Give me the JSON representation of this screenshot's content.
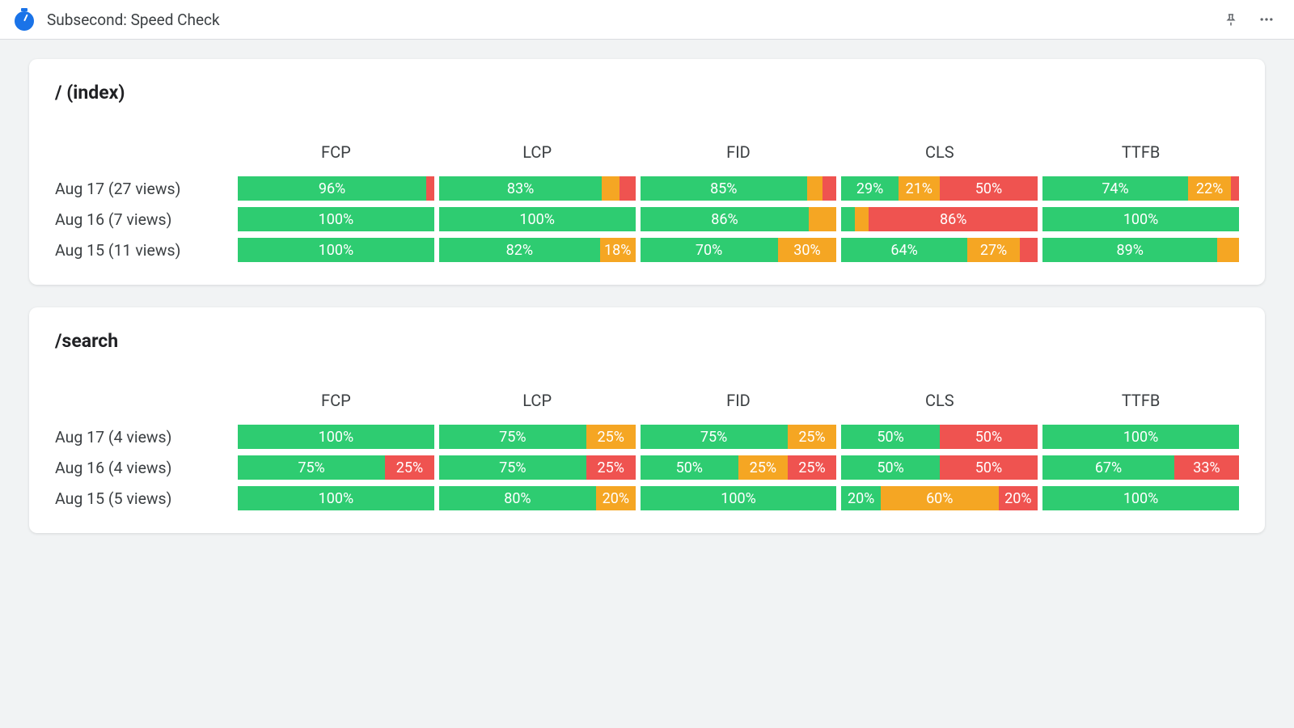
{
  "header": {
    "title": "Subsecond: Speed Check"
  },
  "metrics": [
    "FCP",
    "LCP",
    "FID",
    "CLS",
    "TTFB"
  ],
  "colors": {
    "green": "#2ecc71",
    "orange": "#f5a623",
    "red": "#ef5350"
  },
  "label_threshold_pct": 18,
  "cards": [
    {
      "title": "/ (index)",
      "rows": [
        {
          "label": "Aug 17 (27 views)",
          "cells": [
            [
              {
                "pct": 96,
                "cls": "green"
              },
              {
                "pct": 4,
                "cls": "red"
              }
            ],
            [
              {
                "pct": 83,
                "cls": "green"
              },
              {
                "pct": 9,
                "cls": "orange"
              },
              {
                "pct": 8,
                "cls": "red"
              }
            ],
            [
              {
                "pct": 85,
                "cls": "green"
              },
              {
                "pct": 8,
                "cls": "orange"
              },
              {
                "pct": 7,
                "cls": "red"
              }
            ],
            [
              {
                "pct": 29,
                "cls": "green"
              },
              {
                "pct": 21,
                "cls": "orange"
              },
              {
                "pct": 50,
                "cls": "red"
              }
            ],
            [
              {
                "pct": 74,
                "cls": "green"
              },
              {
                "pct": 22,
                "cls": "orange"
              },
              {
                "pct": 4,
                "cls": "red"
              }
            ]
          ]
        },
        {
          "label": "Aug 16 (7 views)",
          "cells": [
            [
              {
                "pct": 100,
                "cls": "green"
              }
            ],
            [
              {
                "pct": 100,
                "cls": "green"
              }
            ],
            [
              {
                "pct": 86,
                "cls": "green"
              },
              {
                "pct": 14,
                "cls": "orange"
              }
            ],
            [
              {
                "pct": 7,
                "cls": "green"
              },
              {
                "pct": 7,
                "cls": "orange"
              },
              {
                "pct": 86,
                "cls": "red"
              }
            ],
            [
              {
                "pct": 100,
                "cls": "green"
              }
            ]
          ]
        },
        {
          "label": "Aug 15 (11 views)",
          "cells": [
            [
              {
                "pct": 100,
                "cls": "green"
              }
            ],
            [
              {
                "pct": 82,
                "cls": "green"
              },
              {
                "pct": 18,
                "cls": "orange"
              }
            ],
            [
              {
                "pct": 70,
                "cls": "green"
              },
              {
                "pct": 30,
                "cls": "orange"
              }
            ],
            [
              {
                "pct": 64,
                "cls": "green"
              },
              {
                "pct": 27,
                "cls": "orange"
              },
              {
                "pct": 9,
                "cls": "red"
              }
            ],
            [
              {
                "pct": 89,
                "cls": "green"
              },
              {
                "pct": 11,
                "cls": "orange"
              }
            ]
          ]
        }
      ]
    },
    {
      "title": "/search",
      "rows": [
        {
          "label": "Aug 17 (4 views)",
          "cells": [
            [
              {
                "pct": 100,
                "cls": "green"
              }
            ],
            [
              {
                "pct": 75,
                "cls": "green"
              },
              {
                "pct": 25,
                "cls": "orange"
              }
            ],
            [
              {
                "pct": 75,
                "cls": "green"
              },
              {
                "pct": 25,
                "cls": "orange"
              }
            ],
            [
              {
                "pct": 50,
                "cls": "green"
              },
              {
                "pct": 50,
                "cls": "red"
              }
            ],
            [
              {
                "pct": 100,
                "cls": "green"
              }
            ]
          ]
        },
        {
          "label": "Aug 16 (4 views)",
          "cells": [
            [
              {
                "pct": 75,
                "cls": "green"
              },
              {
                "pct": 25,
                "cls": "red"
              }
            ],
            [
              {
                "pct": 75,
                "cls": "green"
              },
              {
                "pct": 25,
                "cls": "red"
              }
            ],
            [
              {
                "pct": 50,
                "cls": "green"
              },
              {
                "pct": 25,
                "cls": "orange"
              },
              {
                "pct": 25,
                "cls": "red"
              }
            ],
            [
              {
                "pct": 50,
                "cls": "green"
              },
              {
                "pct": 50,
                "cls": "red"
              }
            ],
            [
              {
                "pct": 67,
                "cls": "green"
              },
              {
                "pct": 33,
                "cls": "red"
              }
            ]
          ]
        },
        {
          "label": "Aug 15 (5 views)",
          "cells": [
            [
              {
                "pct": 100,
                "cls": "green"
              }
            ],
            [
              {
                "pct": 80,
                "cls": "green"
              },
              {
                "pct": 20,
                "cls": "orange"
              }
            ],
            [
              {
                "pct": 100,
                "cls": "green"
              }
            ],
            [
              {
                "pct": 20,
                "cls": "green"
              },
              {
                "pct": 60,
                "cls": "orange"
              },
              {
                "pct": 20,
                "cls": "red"
              }
            ],
            [
              {
                "pct": 100,
                "cls": "green"
              }
            ]
          ]
        }
      ]
    }
  ],
  "chart_data": {
    "type": "bar",
    "note": "Stacked horizontal percentage bars per metric per day. green=good, orange=needs-improvement, red=poor. Values are percentages that sum to ~100 per cell.",
    "metrics": [
      "FCP",
      "LCP",
      "FID",
      "CLS",
      "TTFB"
    ],
    "pages": [
      {
        "path": "/ (index)",
        "days": [
          {
            "day": "Aug 17",
            "views": 27,
            "FCP": {
              "g": 96,
              "o": 0,
              "r": 4
            },
            "LCP": {
              "g": 83,
              "o": 9,
              "r": 8
            },
            "FID": {
              "g": 85,
              "o": 8,
              "r": 7
            },
            "CLS": {
              "g": 29,
              "o": 21,
              "r": 50
            },
            "TTFB": {
              "g": 74,
              "o": 22,
              "r": 4
            }
          },
          {
            "day": "Aug 16",
            "views": 7,
            "FCP": {
              "g": 100,
              "o": 0,
              "r": 0
            },
            "LCP": {
              "g": 100,
              "o": 0,
              "r": 0
            },
            "FID": {
              "g": 86,
              "o": 14,
              "r": 0
            },
            "CLS": {
              "g": 7,
              "o": 7,
              "r": 86
            },
            "TTFB": {
              "g": 100,
              "o": 0,
              "r": 0
            }
          },
          {
            "day": "Aug 15",
            "views": 11,
            "FCP": {
              "g": 100,
              "o": 0,
              "r": 0
            },
            "LCP": {
              "g": 82,
              "o": 18,
              "r": 0
            },
            "FID": {
              "g": 70,
              "o": 30,
              "r": 0
            },
            "CLS": {
              "g": 64,
              "o": 27,
              "r": 9
            },
            "TTFB": {
              "g": 89,
              "o": 11,
              "r": 0
            }
          }
        ]
      },
      {
        "path": "/search",
        "days": [
          {
            "day": "Aug 17",
            "views": 4,
            "FCP": {
              "g": 100,
              "o": 0,
              "r": 0
            },
            "LCP": {
              "g": 75,
              "o": 25,
              "r": 0
            },
            "FID": {
              "g": 75,
              "o": 25,
              "r": 0
            },
            "CLS": {
              "g": 50,
              "o": 0,
              "r": 50
            },
            "TTFB": {
              "g": 100,
              "o": 0,
              "r": 0
            }
          },
          {
            "day": "Aug 16",
            "views": 4,
            "FCP": {
              "g": 75,
              "o": 0,
              "r": 25
            },
            "LCP": {
              "g": 75,
              "o": 0,
              "r": 25
            },
            "FID": {
              "g": 50,
              "o": 25,
              "r": 25
            },
            "CLS": {
              "g": 50,
              "o": 0,
              "r": 50
            },
            "TTFB": {
              "g": 67,
              "o": 0,
              "r": 33
            }
          },
          {
            "day": "Aug 15",
            "views": 5,
            "FCP": {
              "g": 100,
              "o": 0,
              "r": 0
            },
            "LCP": {
              "g": 80,
              "o": 20,
              "r": 0
            },
            "FID": {
              "g": 100,
              "o": 0,
              "r": 0
            },
            "CLS": {
              "g": 20,
              "o": 60,
              "r": 20
            },
            "TTFB": {
              "g": 100,
              "o": 0,
              "r": 0
            }
          }
        ]
      }
    ]
  }
}
